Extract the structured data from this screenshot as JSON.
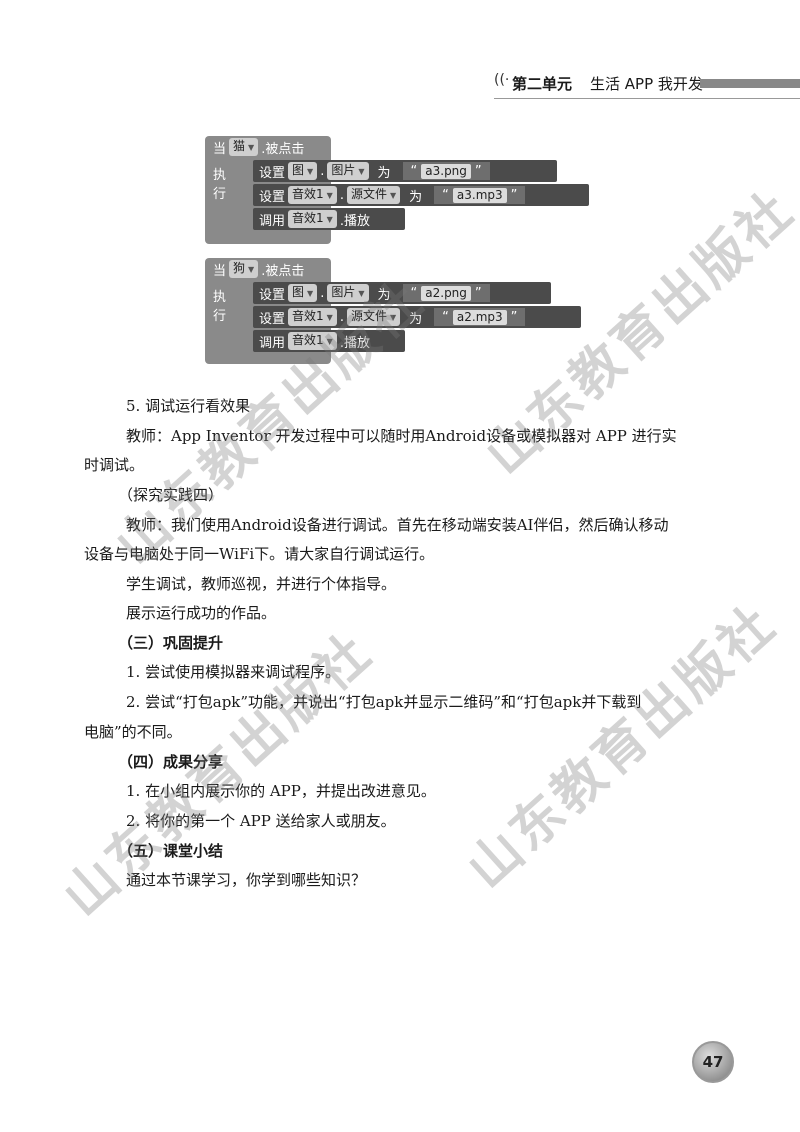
{
  "header": {
    "unit": "第二单元",
    "title": "生活 APP 我开发"
  },
  "blocks": [
    {
      "event": {
        "when": "当",
        "component": "猫",
        "suffix": ".被点击"
      },
      "exec_label": "执行",
      "statements": [
        {
          "keyword": "设置",
          "comp": "图",
          "prop": "图片",
          "to": "为",
          "value": "a3.png"
        },
        {
          "keyword": "设置",
          "comp": "音效1",
          "prop": "源文件",
          "to": "为",
          "value": "a3.mp3"
        },
        {
          "keyword": "调用",
          "comp": "音效1",
          "method": ".播放"
        }
      ]
    },
    {
      "event": {
        "when": "当",
        "component": "狗",
        "suffix": ".被点击"
      },
      "exec_label": "执行",
      "statements": [
        {
          "keyword": "设置",
          "comp": "图",
          "prop": "图片",
          "to": "为",
          "value": "a2.png"
        },
        {
          "keyword": "设置",
          "comp": "音效1",
          "prop": "源文件",
          "to": "为",
          "value": "a2.mp3"
        },
        {
          "keyword": "调用",
          "comp": "音效1",
          "method": ".播放"
        }
      ]
    }
  ],
  "body": {
    "p1": "5. 调试运行看效果",
    "p2a": "教师：App Inventor 开发过程中可以随时用Android设备或模拟器对 APP 进行实",
    "p2b": "时调试。",
    "p3": "（探究实践四）",
    "p4a": "教师：我们使用Android设备进行调试。首先在移动端安装AI伴侣，然后确认移动",
    "p4b": "设备与电脑处于同一WiFi下。请大家自行调试运行。",
    "p5": "学生调试，教师巡视，并进行个体指导。",
    "p6": "展示运行成功的作品。",
    "h3": "（三）巩固提升",
    "p7": "1. 尝试使用模拟器来调试程序。",
    "p8a": "2. 尝试“打包apk”功能，并说出“打包apk并显示二维码”和“打包apk并下载到",
    "p8b": "电脑”的不同。",
    "h4": "（四）成果分享",
    "p9": "1. 在小组内展示你的 APP，并提出改进意见。",
    "p10": "2. 将你的第一个 APP 送给家人或朋友。",
    "h5": "（五）课堂小结",
    "p11": "通过本节课学习，你学到哪些知识？"
  },
  "watermark": "山东教育出版社",
  "page_number": "47"
}
